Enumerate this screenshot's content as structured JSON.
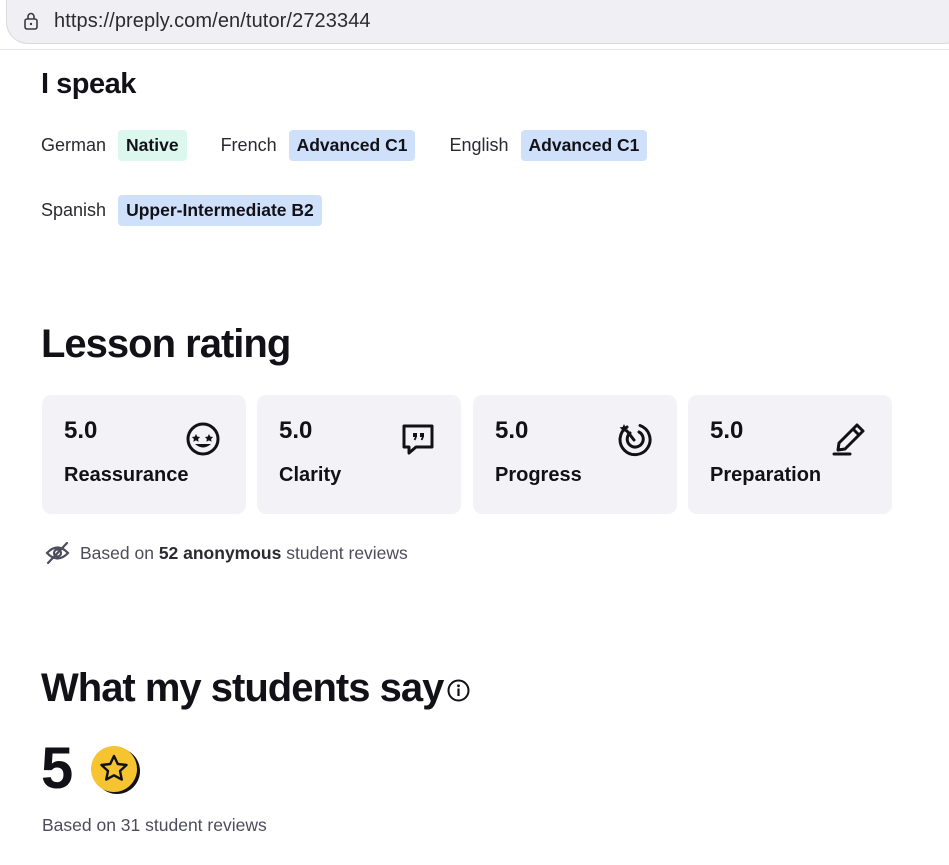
{
  "browser": {
    "url": "https://preply.com/en/tutor/2723344"
  },
  "languages": {
    "heading": "I speak",
    "items": [
      {
        "name": "German",
        "level": "Native",
        "kind": "native"
      },
      {
        "name": "French",
        "level": "Advanced C1",
        "kind": "adv"
      },
      {
        "name": "English",
        "level": "Advanced C1",
        "kind": "adv"
      },
      {
        "name": "Spanish",
        "level": "Upper-Intermediate B2",
        "kind": "adv"
      }
    ]
  },
  "rating": {
    "heading": "Lesson rating",
    "cards": [
      {
        "score": "5.0",
        "label": "Reassurance",
        "icon": "smiley-star-eyes-icon"
      },
      {
        "score": "5.0",
        "label": "Clarity",
        "icon": "speech-bubble-quote-icon"
      },
      {
        "score": "5.0",
        "label": "Progress",
        "icon": "target-progress-icon"
      },
      {
        "score": "5.0",
        "label": "Preparation",
        "icon": "pencil-icon"
      }
    ],
    "anonymous": {
      "prefix": "Based on ",
      "count_phrase": "52 anonymous",
      "suffix": " student reviews",
      "icon": "eye-off-icon"
    }
  },
  "reviews": {
    "heading": "What my students say",
    "info_icon": "info-icon",
    "score": "5",
    "score_icon": "star-badge-icon",
    "based_on": "Based on 31 student reviews"
  },
  "colors": {
    "native_badge": "#dcf7ee",
    "advanced_badge": "#cfe0fb",
    "card_bg": "#f3f3f7",
    "star_gold": "#f5c430"
  }
}
